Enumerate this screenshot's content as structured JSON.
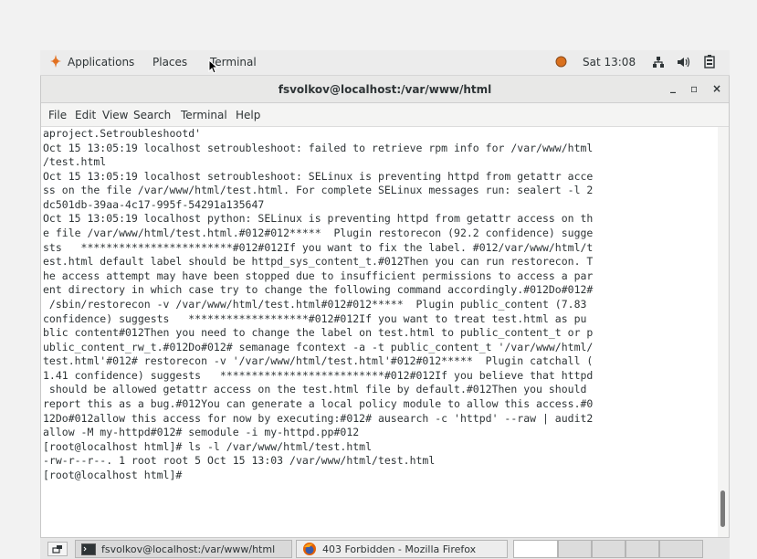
{
  "topbar": {
    "applications": "Applications",
    "places": "Places",
    "terminal": "Terminal",
    "clock": "Sat 13:08"
  },
  "window": {
    "title": "fsvolkov@localhost:/var/www/html",
    "minimize": "_",
    "maximize": "▫",
    "close": "×"
  },
  "menu": [
    "File",
    "Edit",
    "View",
    "Search",
    "Terminal",
    "Help"
  ],
  "terminal_lines": [
    "aproject.Setroubleshootd'",
    "Oct 15 13:05:19 localhost setroubleshoot: failed to retrieve rpm info for /var/www/html",
    "/test.html",
    "Oct 15 13:05:19 localhost setroubleshoot: SELinux is preventing httpd from getattr acce",
    "ss on the file /var/www/html/test.html. For complete SELinux messages run: sealert -l 2",
    "dc501db-39aa-4c17-995f-54291a135647",
    "Oct 15 13:05:19 localhost python: SELinux is preventing httpd from getattr access on th",
    "e file /var/www/html/test.html.#012#012*****  Plugin restorecon (92.2 confidence) sugge",
    "sts   ************************#012#012If you want to fix the label. #012/var/www/html/t",
    "est.html default label should be httpd_sys_content_t.#012Then you can run restorecon. T",
    "he access attempt may have been stopped due to insufficient permissions to access a par",
    "ent directory in which case try to change the following command accordingly.#012Do#012#",
    " /sbin/restorecon -v /var/www/html/test.html#012#012*****  Plugin public_content (7.83",
    "confidence) suggests   *******************#012#012If you want to treat test.html as pu",
    "blic content#012Then you need to change the label on test.html to public_content_t or p",
    "ublic_content_rw_t.#012Do#012# semanage fcontext -a -t public_content_t '/var/www/html/",
    "test.html'#012# restorecon -v '/var/www/html/test.html'#012#012*****  Plugin catchall (",
    "1.41 confidence) suggests   **************************#012#012If you believe that httpd",
    " should be allowed getattr access on the test.html file by default.#012Then you should",
    "report this as a bug.#012You can generate a local policy module to allow this access.#0",
    "12Do#012allow this access for now by executing:#012# ausearch -c 'httpd' --raw | audit2",
    "allow -M my-httpd#012# semodule -i my-httpd.pp#012",
    "[root@localhost html]# ls -l /var/www/html/test.html",
    "-rw-r--r--. 1 root root 5 Oct 15 13:03 /var/www/html/test.html",
    "[root@localhost html]# "
  ],
  "taskbar": {
    "terminal_task": "fsvolkov@localhost:/var/www/html",
    "firefox_task": "403 Forbidden - Mozilla Firefox"
  }
}
